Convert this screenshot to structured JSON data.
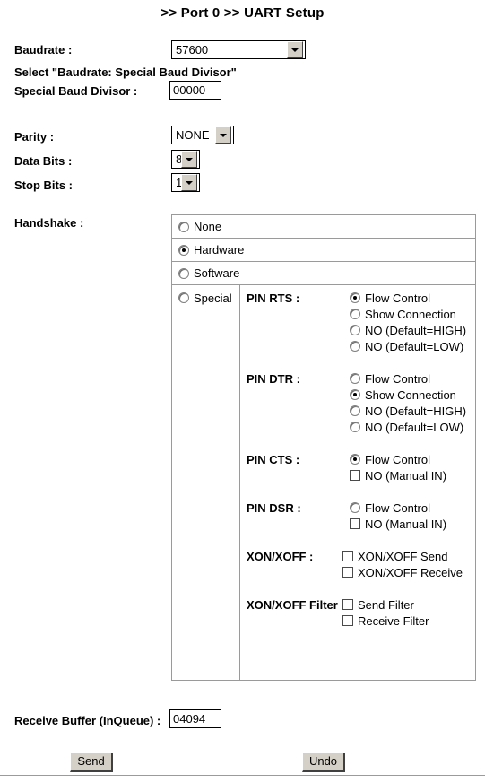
{
  "page": {
    "title": ">> Port 0 >> UART Setup"
  },
  "form": {
    "baudrate": {
      "label": "Baudrate :",
      "value": "57600",
      "options": [
        "57600"
      ]
    },
    "note": "Select \"Baudrate: Special Baud Divisor\"",
    "special_baud_divisor": {
      "label": "Special Baud Divisor :",
      "value": "00000"
    },
    "parity": {
      "label": "Parity :",
      "value": "NONE",
      "options": [
        "NONE"
      ]
    },
    "data_bits": {
      "label": "Data Bits :",
      "value": "8",
      "options": [
        "8"
      ]
    },
    "stop_bits": {
      "label": "Stop Bits :",
      "value": "1",
      "options": [
        "1"
      ]
    },
    "handshake": {
      "label": "Handshake :",
      "modes": [
        {
          "label": "None",
          "selected": false
        },
        {
          "label": "Hardware",
          "selected": true
        },
        {
          "label": "Software",
          "selected": false
        },
        {
          "label": "Special",
          "selected": false
        }
      ],
      "pins": [
        {
          "label": "PIN RTS :",
          "options": [
            {
              "label": "Flow Control",
              "type": "radio",
              "selected": true
            },
            {
              "label": "Show Connection",
              "type": "radio",
              "selected": false
            },
            {
              "label": "NO (Default=HIGH)",
              "type": "radio",
              "selected": false
            },
            {
              "label": "NO (Default=LOW)",
              "type": "radio",
              "selected": false
            }
          ]
        },
        {
          "label": "PIN DTR :",
          "options": [
            {
              "label": "Flow Control",
              "type": "radio",
              "selected": false
            },
            {
              "label": "Show Connection",
              "type": "radio",
              "selected": true
            },
            {
              "label": "NO (Default=HIGH)",
              "type": "radio",
              "selected": false
            },
            {
              "label": "NO (Default=LOW)",
              "type": "radio",
              "selected": false
            }
          ]
        },
        {
          "label": "PIN CTS :",
          "options": [
            {
              "label": "Flow Control",
              "type": "radio",
              "selected": true
            },
            {
              "label": "NO (Manual IN)",
              "type": "checkbox",
              "selected": false
            }
          ]
        },
        {
          "label": "PIN DSR :",
          "options": [
            {
              "label": "Flow Control",
              "type": "radio",
              "selected": false
            },
            {
              "label": "NO (Manual IN)",
              "type": "checkbox",
              "selected": false
            }
          ]
        },
        {
          "label": "XON/XOFF :",
          "options": [
            {
              "label": "XON/XOFF Send",
              "type": "checkbox",
              "selected": false
            },
            {
              "label": "XON/XOFF Receive",
              "type": "checkbox",
              "selected": false
            }
          ]
        },
        {
          "label": "XON/XOFF Filter :",
          "tight": true,
          "options": [
            {
              "label": "Send Filter",
              "type": "checkbox",
              "selected": false
            },
            {
              "label": "Receive Filter",
              "type": "checkbox",
              "selected": false
            }
          ]
        }
      ]
    },
    "receive_buffer": {
      "label": "Receive Buffer (InQueue) :",
      "value": "04094"
    }
  },
  "actions": {
    "send_label": "Send",
    "undo_label": "Undo"
  }
}
